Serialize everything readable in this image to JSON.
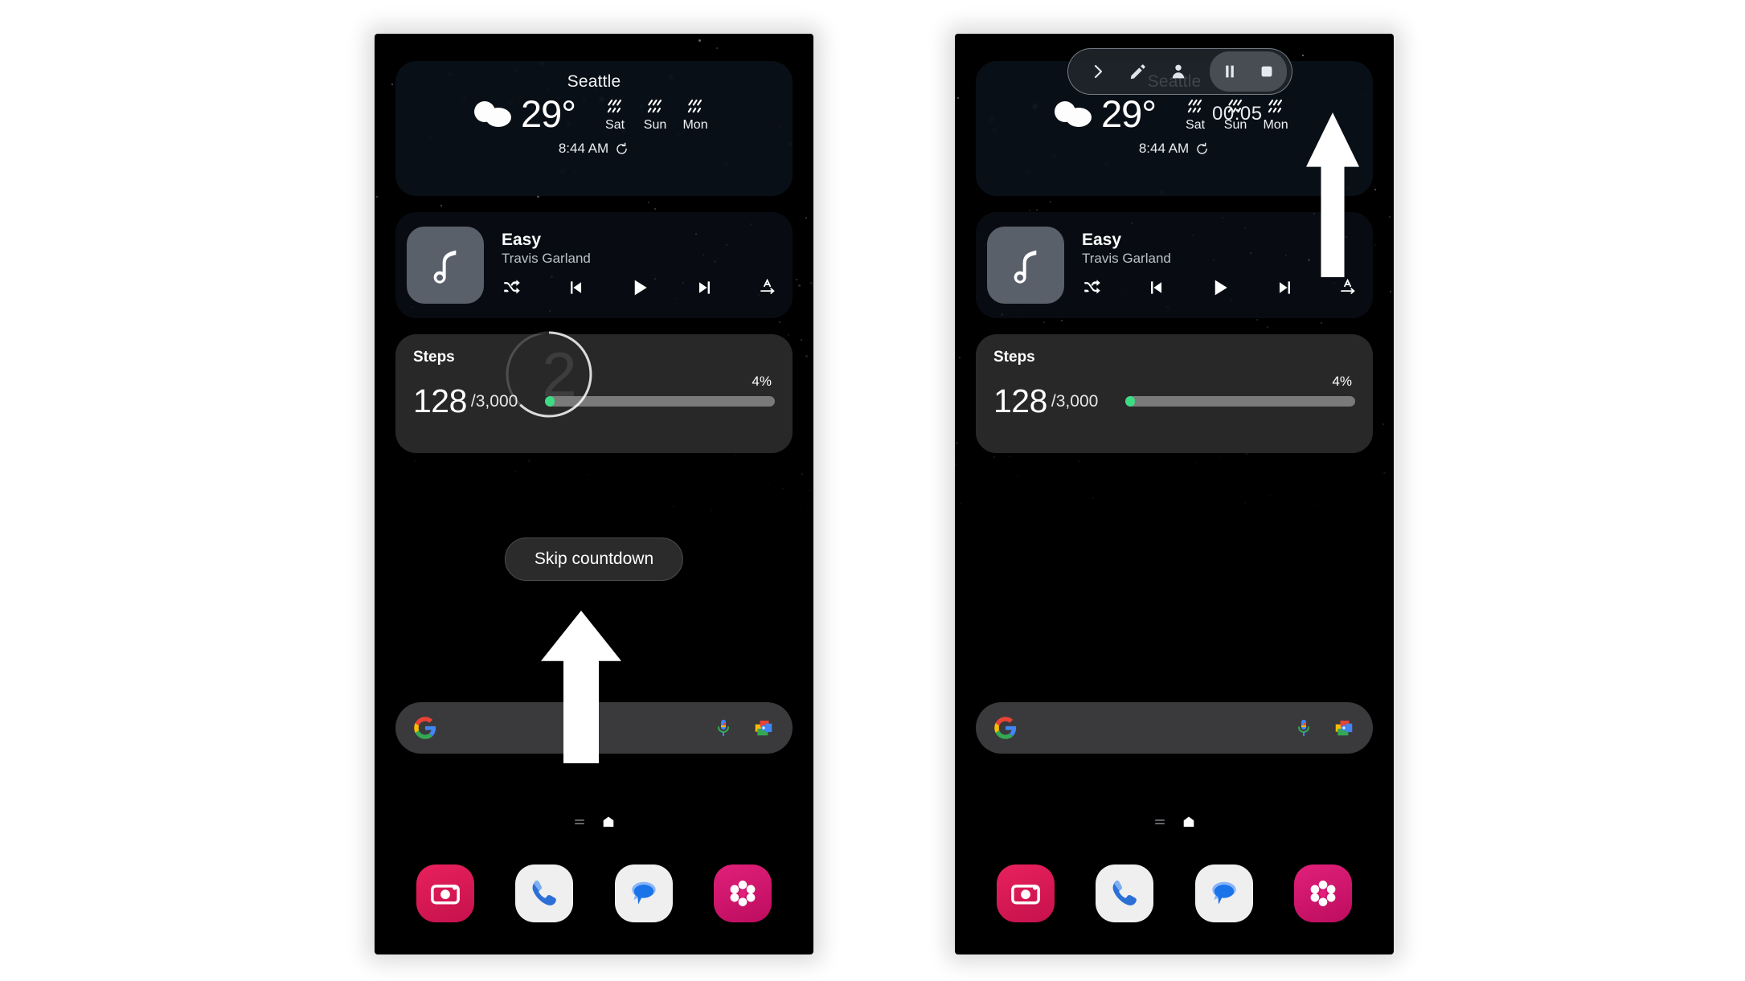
{
  "screens": [
    {
      "id": "left",
      "name": "home-screen-with-countdown",
      "weather": {
        "city": "Seattle",
        "temperature": "29°",
        "condition_icon": "partly-cloudy-icon",
        "forecast": [
          {
            "day": "Sat",
            "icon": "rain-icon"
          },
          {
            "day": "Sun",
            "icon": "rain-icon"
          },
          {
            "day": "Mon",
            "icon": "rain-icon"
          }
        ],
        "updated_time": "8:44 AM",
        "refresh_icon": "refresh-icon"
      },
      "music": {
        "album_art_icon": "music-note-icon",
        "title": "Easy",
        "artist": "Travis Garland",
        "controls": [
          {
            "name": "shuffle-button",
            "icon": "shuffle-icon"
          },
          {
            "name": "previous-button",
            "icon": "skip-previous-icon"
          },
          {
            "name": "play-button",
            "icon": "play-icon"
          },
          {
            "name": "next-button",
            "icon": "skip-next-icon"
          },
          {
            "name": "repeat-all-button",
            "icon": "repeat-a-arrow-icon"
          }
        ]
      },
      "steps": {
        "label": "Steps",
        "count": "128",
        "goal": "/3,000",
        "percent_label": "4%",
        "percent_value": 4,
        "bar_color": "#3ddc84"
      },
      "countdown": {
        "visible": true,
        "value": "2",
        "ring_progress": 0.62
      },
      "skip_button": {
        "visible": true,
        "label": "Skip countdown"
      },
      "search": {
        "logo_icon": "google-g-icon",
        "placeholder": "",
        "mic_icon": "microphone-icon",
        "lens_icon": "google-lens-icon"
      },
      "page_indicator": [
        {
          "name": "page-dot-list",
          "icon": "list-lines-icon",
          "active": false
        },
        {
          "name": "page-dot-home",
          "icon": "home-icon",
          "active": true
        }
      ],
      "dock": [
        {
          "name": "camera-app",
          "label": "Camera",
          "icon": "camera-icon",
          "color": "#e8215c"
        },
        {
          "name": "phone-app",
          "label": "Phone",
          "icon": "phone-icon",
          "color": "#efefef"
        },
        {
          "name": "messages-app",
          "label": "Messages",
          "icon": "message-bubble-icon",
          "color": "#efefef"
        },
        {
          "name": "gallery-app",
          "label": "Gallery",
          "icon": "flower-icon",
          "color": "#e0207a"
        }
      ],
      "recorder": {
        "visible": false
      },
      "annotation_arrow": {
        "visible": true,
        "direction": "up"
      }
    },
    {
      "id": "right",
      "name": "home-screen-recording-active",
      "weather": {
        "city": "Seattle",
        "temperature": "29°",
        "condition_icon": "partly-cloudy-icon",
        "forecast": [
          {
            "day": "Sat",
            "icon": "rain-icon"
          },
          {
            "day": "Sun",
            "icon": "rain-icon"
          },
          {
            "day": "Mon",
            "icon": "rain-icon"
          }
        ],
        "updated_time": "8:44 AM",
        "refresh_icon": "refresh-icon"
      },
      "music": {
        "album_art_icon": "music-note-icon",
        "title": "Easy",
        "artist": "Travis Garland",
        "controls": [
          {
            "name": "shuffle-button",
            "icon": "shuffle-icon"
          },
          {
            "name": "previous-button",
            "icon": "skip-previous-icon"
          },
          {
            "name": "play-button",
            "icon": "play-icon"
          },
          {
            "name": "next-button",
            "icon": "skip-next-icon"
          },
          {
            "name": "repeat-all-button",
            "icon": "repeat-a-arrow-icon"
          }
        ]
      },
      "steps": {
        "label": "Steps",
        "count": "128",
        "goal": "/3,000",
        "percent_label": "4%",
        "percent_value": 4,
        "bar_color": "#3ddc84"
      },
      "countdown": {
        "visible": false,
        "value": "",
        "ring_progress": 0
      },
      "skip_button": {
        "visible": false,
        "label": "Skip countdown"
      },
      "search": {
        "logo_icon": "google-g-icon",
        "placeholder": "",
        "mic_icon": "microphone-icon",
        "lens_icon": "google-lens-icon"
      },
      "page_indicator": [
        {
          "name": "page-dot-list",
          "icon": "list-lines-icon",
          "active": false
        },
        {
          "name": "page-dot-home",
          "icon": "home-icon",
          "active": true
        }
      ],
      "dock": [
        {
          "name": "camera-app",
          "label": "Camera",
          "icon": "camera-icon",
          "color": "#e8215c"
        },
        {
          "name": "phone-app",
          "label": "Phone",
          "icon": "phone-icon",
          "color": "#efefef"
        },
        {
          "name": "messages-app",
          "label": "Messages",
          "icon": "message-bubble-icon",
          "color": "#efefef"
        },
        {
          "name": "gallery-app",
          "label": "Gallery",
          "icon": "flower-icon",
          "color": "#e0207a"
        }
      ],
      "recorder": {
        "visible": true,
        "timer": "00:05",
        "buttons": [
          {
            "name": "expand-toolbar-button",
            "icon": "chevron-right-icon"
          },
          {
            "name": "draw-button",
            "icon": "pencil-icon"
          },
          {
            "name": "selfie-overlay-button",
            "icon": "person-icon"
          },
          {
            "name": "pause-recording-button",
            "icon": "pause-icon"
          },
          {
            "name": "stop-recording-button",
            "icon": "stop-icon"
          }
        ]
      },
      "annotation_arrow": {
        "visible": true,
        "direction": "up"
      }
    }
  ],
  "colors": {
    "accent_green": "#3ddc84",
    "widget_dark": "#282828",
    "toolbar_bg": "#22262c",
    "page_bg": "#ffffff"
  }
}
